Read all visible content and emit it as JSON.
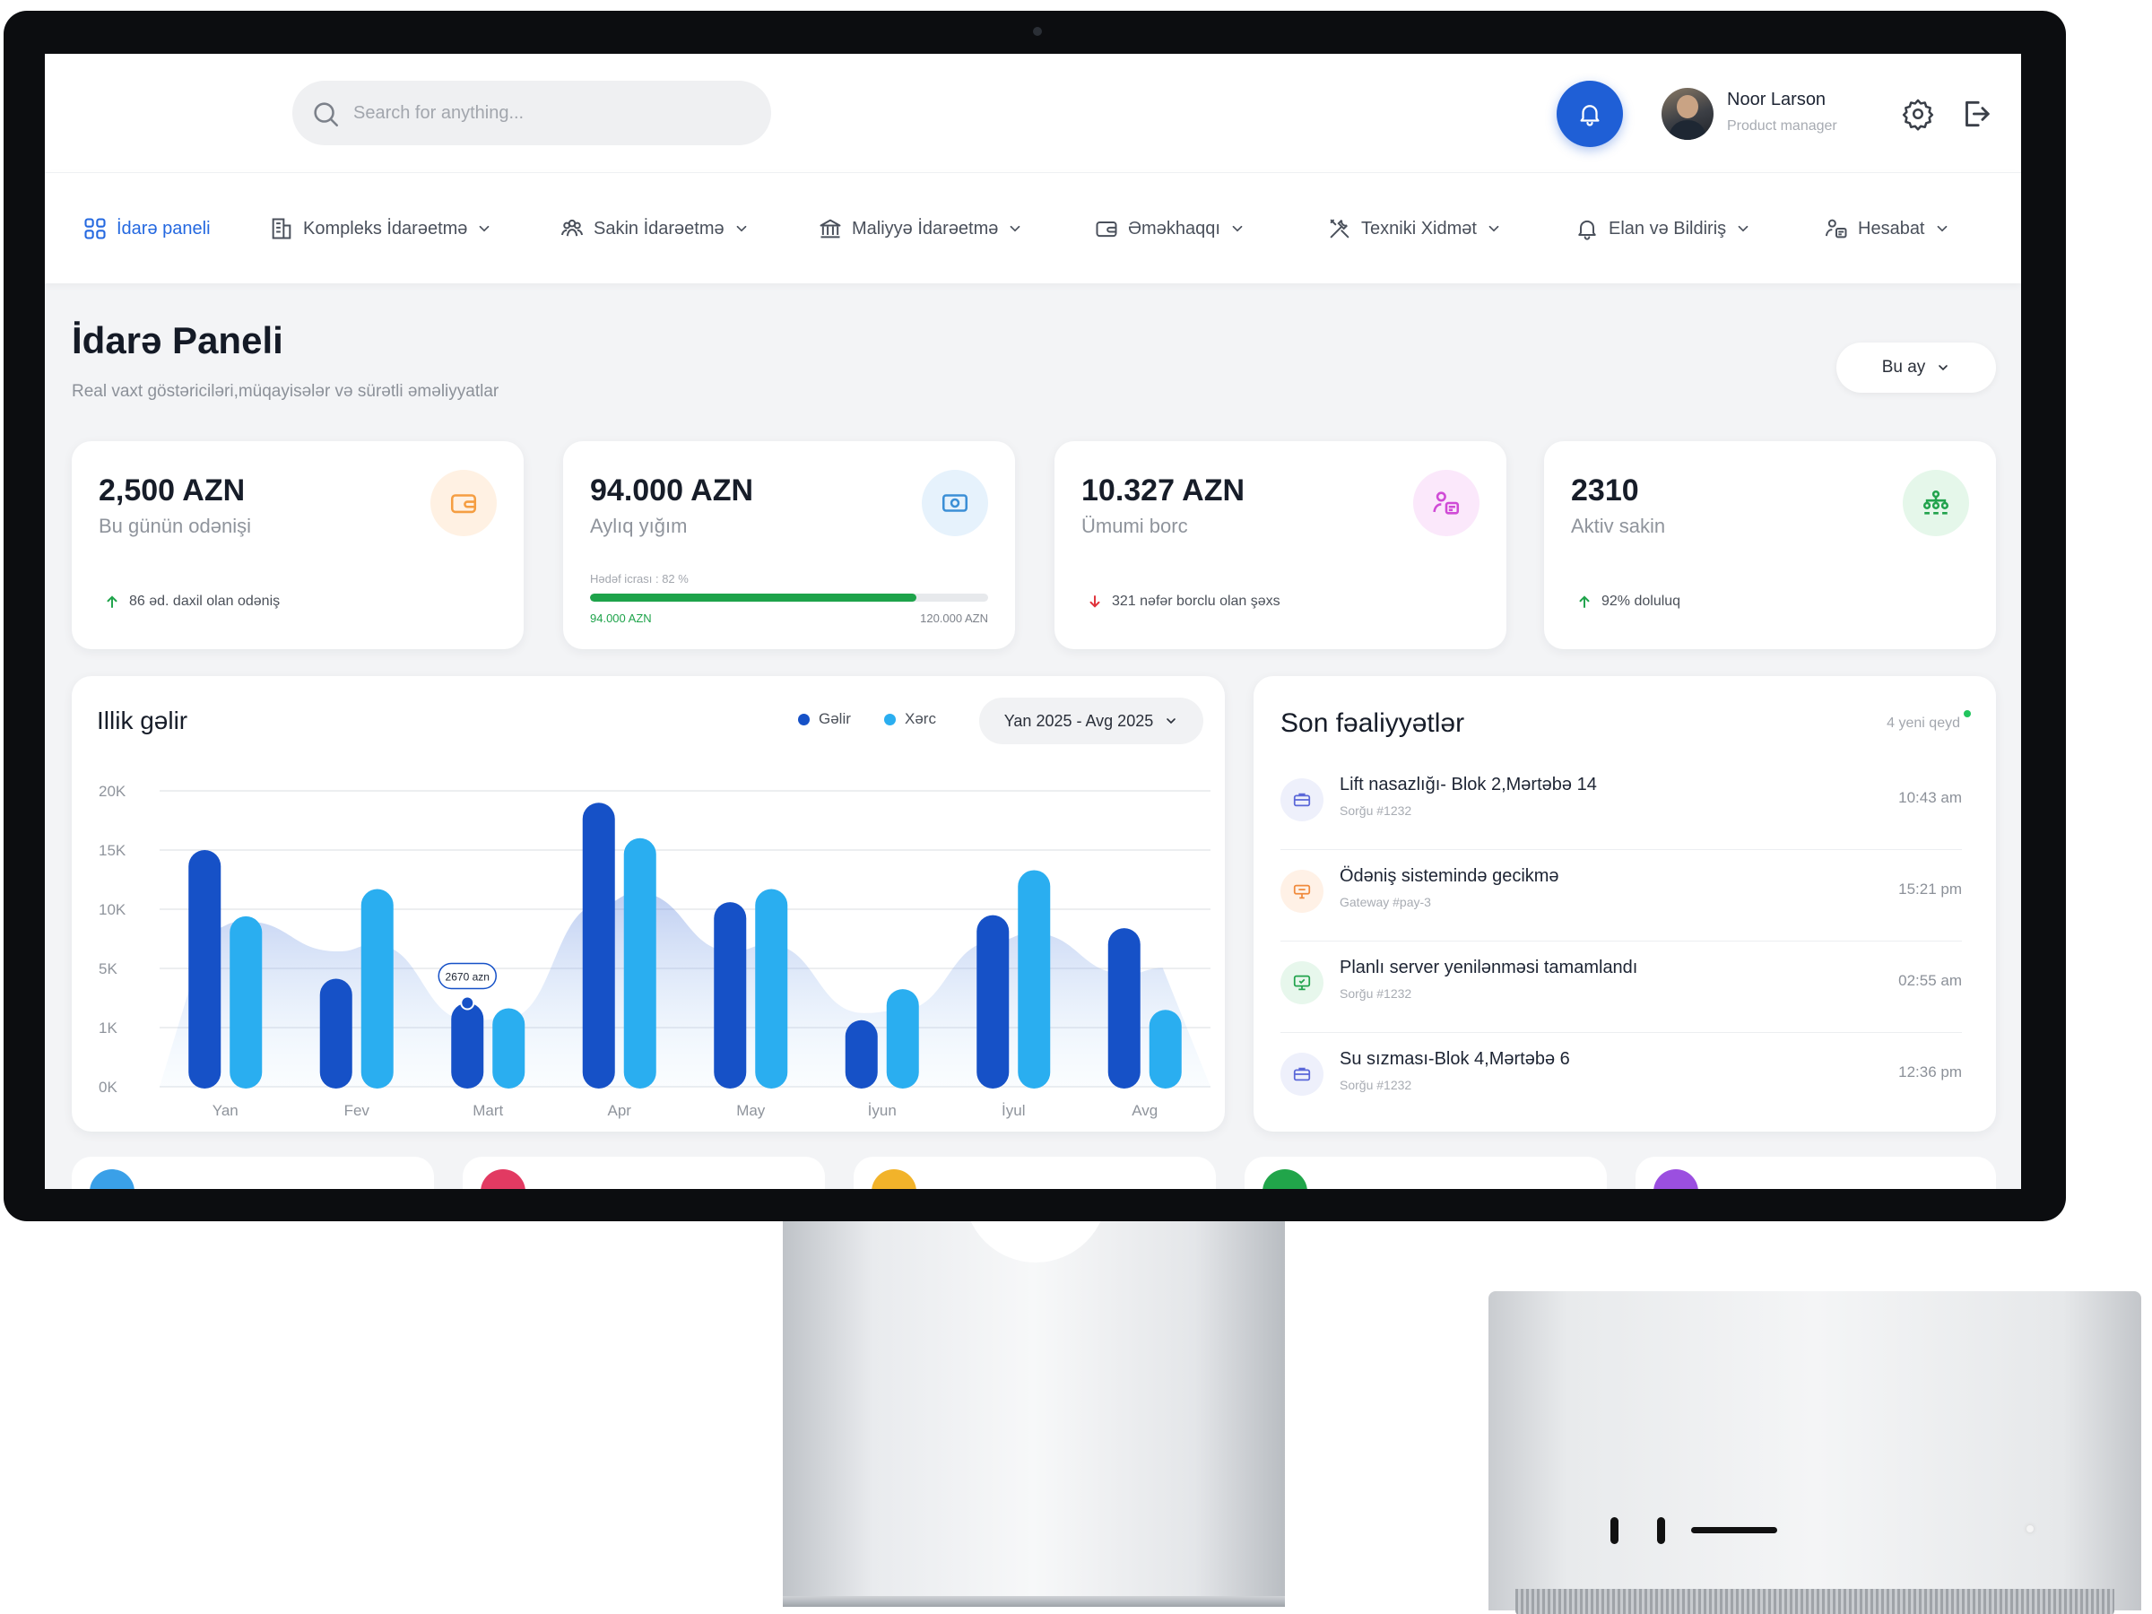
{
  "header": {
    "search_placeholder": "Search for anything...",
    "user": {
      "name": "Noor Larson",
      "role": "Product manager"
    },
    "icons": [
      "search-icon",
      "bell-icon",
      "gear-icon",
      "logout-icon"
    ],
    "accent_color": "#1f5fd6"
  },
  "nav": {
    "items": [
      {
        "label": "İdarə paneli",
        "icon": "grid-icon",
        "active": true,
        "has_dropdown": false
      },
      {
        "label": "Kompleks İdarəetmə",
        "icon": "building-icon",
        "active": false,
        "has_dropdown": true
      },
      {
        "label": "Sakin İdarəetmə",
        "icon": "users-icon",
        "active": false,
        "has_dropdown": true
      },
      {
        "label": "Maliyyə İdarəetmə",
        "icon": "bank-icon",
        "active": false,
        "has_dropdown": true
      },
      {
        "label": "Əməkhaqqı",
        "icon": "wallet-icon",
        "active": false,
        "has_dropdown": true
      },
      {
        "label": "Texniki Xidmət",
        "icon": "tools-icon",
        "active": false,
        "has_dropdown": true
      },
      {
        "label": "Elan və Bildiriş",
        "icon": "bell-icon",
        "active": false,
        "has_dropdown": true
      },
      {
        "label": "Hesabat",
        "icon": "report-icon",
        "active": false,
        "has_dropdown": true
      }
    ]
  },
  "page": {
    "title": "İdarə Paneli",
    "subtitle": "Real vaxt göstəriciləri,müqayisələr və sürətli əməliyyatlar",
    "period": "Bu ay"
  },
  "kpis": [
    {
      "value": "2,500 AZN",
      "label": "Bu günün odənişi",
      "foot": "86 əd. daxil olan odəniş",
      "trend": "up",
      "icon": "wallet-icon",
      "color": "#f59e42",
      "bg": "#fff1e3"
    },
    {
      "value": "94.000 AZN",
      "label": "Aylıq yığım",
      "progress_caption": "Hədəf icrası : 82 %",
      "progress": 0.82,
      "progress_min": "94.000 AZN",
      "progress_max": "120.000 AZN",
      "icon": "cash-icon",
      "color": "#3b8fd6",
      "bg": "#e6f2fc"
    },
    {
      "value": "10.327 AZN",
      "label": "Ümumi borc",
      "foot": "321 nəfər borclu olan şəxs",
      "trend": "down",
      "icon": "users-card-icon",
      "color": "#d04bd6",
      "bg": "#fbe8fb"
    },
    {
      "value": "2310",
      "label": "Aktiv sakin",
      "foot": "92% doluluq",
      "trend": "up",
      "icon": "org-icon",
      "color": "#22a34d",
      "bg": "#e5f7ea"
    }
  ],
  "chart": {
    "title": "Illik gəlir",
    "legend": [
      {
        "name": "Gəlir",
        "color": "#1651c7"
      },
      {
        "name": "Xərc",
        "color": "#2aaef0"
      }
    ],
    "range": "Yan 2025 - Avg 2025",
    "tooltip": "2670 azn"
  },
  "chart_data": {
    "type": "bar",
    "categories": [
      "Yan",
      "Fev",
      "Mart",
      "Apr",
      "May",
      "İyun",
      "İyul",
      "Avg"
    ],
    "y_ticks": [
      "20K",
      "15K",
      "10K",
      "5K",
      "1K",
      "0K"
    ],
    "series": [
      {
        "name": "Gəlir",
        "values": [
          15000,
          4300,
          2670,
          19000,
          10600,
          1500,
          9500,
          8400
        ]
      },
      {
        "name": "Xərc",
        "values": [
          9400,
          11700,
          2300,
          16000,
          11700,
          3600,
          13300,
          2200
        ]
      }
    ],
    "highlight": {
      "category": "Mart",
      "series": "Gəlir",
      "label": "2670 azn"
    },
    "grid": true,
    "legend_position": "top-right"
  },
  "activity": {
    "title": "Son fəaliyyətlər",
    "badge": "4 yeni qeyd",
    "items": [
      {
        "title": "Lift nasazlığı- Blok 2,Mərtəbə 14",
        "ref": "Sorğu #1232",
        "time": "10:43 am",
        "icon": "briefcase-icon",
        "color": "#5a67d8",
        "bg": "#eef0fb"
      },
      {
        "title": "Ödəniş sistemində gecikmə",
        "ref": "Gateway #pay-3",
        "time": "15:21 pm",
        "icon": "card-icon",
        "color": "#f08a3c",
        "bg": "#fff1e6"
      },
      {
        "title": "Planlı server yenilənməsi tamamlandı",
        "ref": "Sorğu #1232",
        "time": "02:55 am",
        "icon": "monitor-icon",
        "color": "#22a34d",
        "bg": "#e7f7ec"
      },
      {
        "title": "Su sızması-Blok 4,Mərtəbə 6",
        "ref": "Sorğu #1232",
        "time": "12:36 pm",
        "icon": "briefcase-icon",
        "color": "#5a67d8",
        "bg": "#eef0fb"
      }
    ]
  },
  "mini_cards": [
    {
      "color": "#3aa0e8"
    },
    {
      "color": "#e23a62"
    },
    {
      "color": "#f2b32a"
    },
    {
      "color": "#21a54a"
    },
    {
      "color": "#9b4fe0"
    }
  ]
}
